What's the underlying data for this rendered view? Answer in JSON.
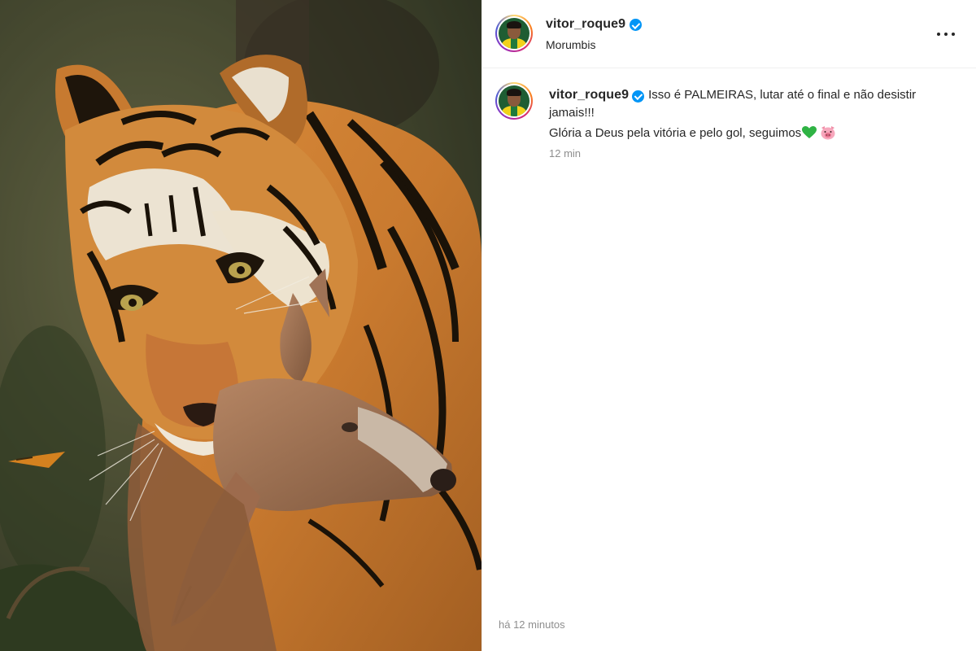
{
  "post": {
    "username": "vitor_roque9",
    "location": "Morumbis",
    "caption_line1": "Isso é PALMEIRAS, lutar até o final e não desistir jamais!!!",
    "caption_line2": "Glória a Deus pela vitória e pelo gol, seguimos",
    "caption_emojis": [
      "green-heart-emoji",
      "pig-face-emoji"
    ],
    "comment_time": "12 min",
    "post_time": "há 12 minutos"
  },
  "icons": {
    "verified": "verified-badge-icon",
    "more": "more-options-icon"
  },
  "colors": {
    "verified_blue": "#0095f6",
    "text_primary": "#262626",
    "text_secondary": "#8e8e8e",
    "divider": "#efefef"
  }
}
